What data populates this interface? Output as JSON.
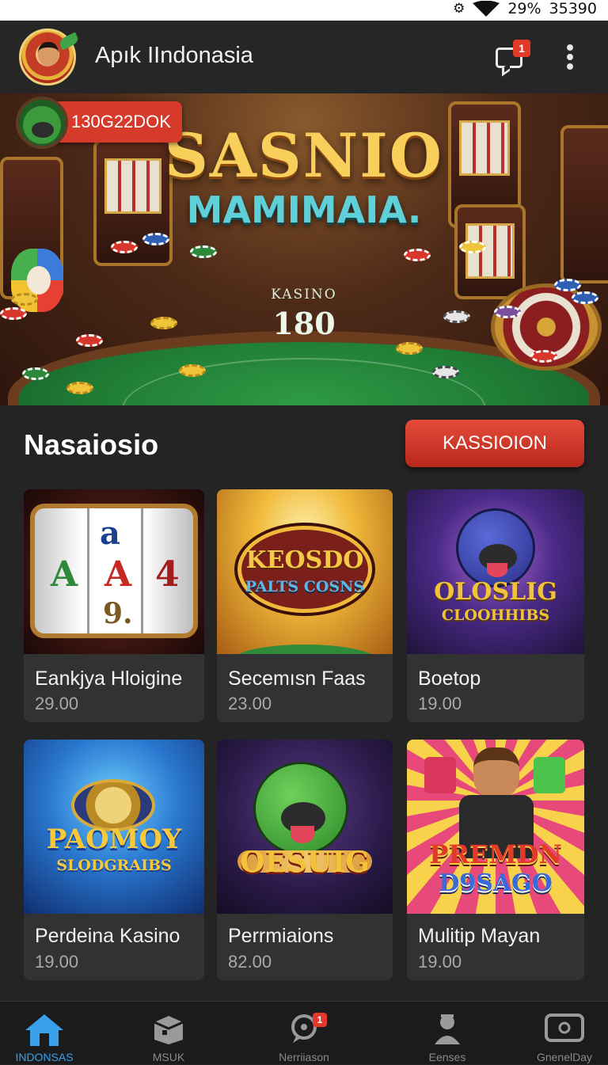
{
  "status_bar": {
    "battery": "29%",
    "time": "35390"
  },
  "app_bar": {
    "title": "Apık IIndonasia",
    "notification_count": "1"
  },
  "hero": {
    "user_balance": "130G22DOK",
    "brand_line_1": "SASNIO",
    "brand_line_2": "MAMIMAIA.",
    "table_label": "KASINO",
    "table_value": "180"
  },
  "section": {
    "title": "Nasaiosio",
    "action_label": "KASSIOION"
  },
  "games": [
    {
      "name": "Eankjya Hloigine",
      "price": "29.00",
      "art": "slot-reels",
      "art_text": [
        "a",
        "A",
        "A",
        "4",
        "9."
      ]
    },
    {
      "name": "Secemısn Faas",
      "price": "23.00",
      "art": "arcade-sign",
      "art_text": [
        "KEOSDO",
        "PALTS COSNS"
      ]
    },
    {
      "name": "Boetop",
      "price": "19.00",
      "art": "mascot-logo",
      "art_text": [
        "OLOSLIG",
        "CLOOHHIBS"
      ]
    },
    {
      "name": "Perdeina Kasino",
      "price": "19.00",
      "art": "chip-logo",
      "art_text": [
        "PAOMOY",
        "SLODGRAIBS"
      ]
    },
    {
      "name": "Perrmiaions",
      "price": "82.00",
      "art": "green-mascot",
      "art_text": [
        "OESUIG"
      ]
    },
    {
      "name": "Mulitip Mayan",
      "price": "19.00",
      "art": "dealer-logo",
      "art_text": [
        "PREMDN",
        "D9SAGO"
      ]
    }
  ],
  "bottom_nav": [
    {
      "label": "INDONSAS",
      "icon": "home-icon",
      "active": true
    },
    {
      "label": "MSUK",
      "icon": "box-icon",
      "active": false
    },
    {
      "label": "Nerriiason",
      "icon": "chat-icon",
      "active": false,
      "badge": "1"
    },
    {
      "label": "Eenses",
      "icon": "dealer-icon",
      "active": false
    },
    {
      "label": "GnenelDay",
      "icon": "screen-icon",
      "active": false
    }
  ],
  "colors": {
    "accent_red": "#d63a2a",
    "active_blue": "#3aa0ec",
    "background": "#242424",
    "card": "#323232"
  }
}
